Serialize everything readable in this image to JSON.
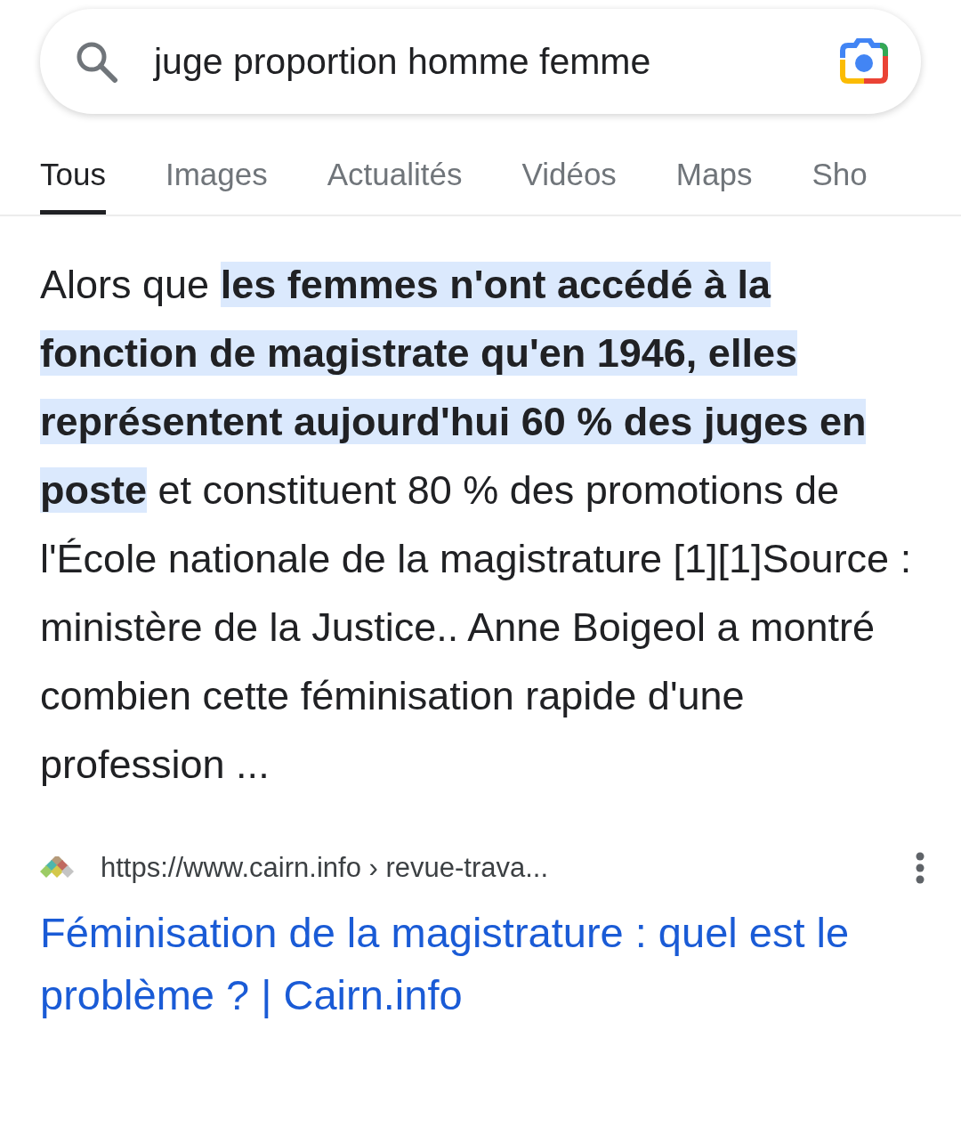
{
  "search": {
    "value": "juge proportion homme femme"
  },
  "tabs": [
    {
      "label": "Tous",
      "selected": true
    },
    {
      "label": "Images",
      "selected": false
    },
    {
      "label": "Actualités",
      "selected": false
    },
    {
      "label": "Vidéos",
      "selected": false
    },
    {
      "label": "Maps",
      "selected": false
    },
    {
      "label": "Sho",
      "selected": false
    }
  ],
  "snippet": [
    {
      "text": "Alors que ",
      "highlighted": false
    },
    {
      "text": "les femmes n'ont accédé à la fonction de magistrate qu'en 1946, elles représentent aujourd'hui 60 % des juges en poste",
      "highlighted": true
    },
    {
      "text": " et constituent 80 % des promotions de l'École nationale de la magistrature [1][1]Source : ministère de la Justice.. Anne Boigeol a montré combien cette féminisation rapide d'une profession ...",
      "highlighted": false
    }
  ],
  "result": {
    "url": "https://www.cairn.info › revue-trava...",
    "title": "Féminisation de la magistrature : quel est le problème ? | Cairn.info"
  }
}
